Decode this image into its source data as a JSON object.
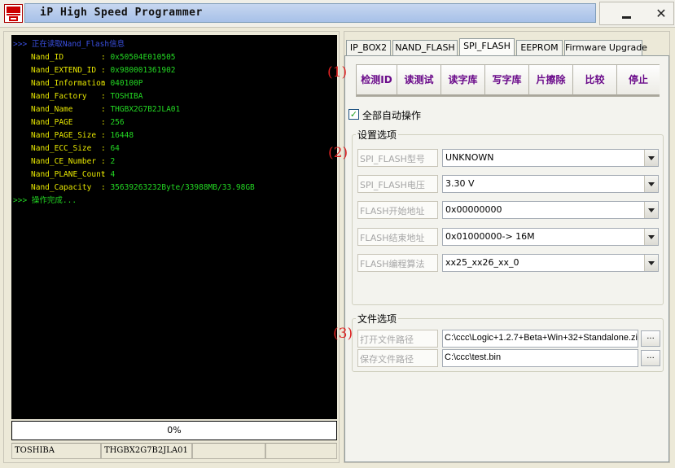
{
  "window": {
    "title": "iP High Speed Programmer"
  },
  "console": {
    "header": ">>> 正在读取Nand_Flash信息",
    "rows": [
      {
        "label": "Nand_ID",
        "value": "0x50504E010505"
      },
      {
        "label": "Nand_EXTEND_ID",
        "value": "0x980001361902"
      },
      {
        "label": "Nand_Information",
        "value": "040100P"
      },
      {
        "label": "Nand_Factory",
        "value": "TOSHIBA"
      },
      {
        "label": "Nand_Name",
        "value": "THGBX2G7B2JLA01"
      },
      {
        "label": "Nand_PAGE",
        "value": "256"
      },
      {
        "label": "Nand_PAGE_Size",
        "value": "16448"
      },
      {
        "label": "Nand_ECC_Size",
        "value": "64"
      },
      {
        "label": "Nand_CE_Number",
        "value": "2"
      },
      {
        "label": "Nand_PLANE_Count",
        "value": "4"
      },
      {
        "label": "Nand_Capacity",
        "value": "35639263232Byte/33988MB/33.98GB"
      }
    ],
    "separator": ": ",
    "footer": ">>> 操作完成..."
  },
  "progress": {
    "percent": 0,
    "label": "0%"
  },
  "statusbar": {
    "cells": [
      "TOSHIBA",
      "THGBX2G7B2JLA01",
      "",
      ""
    ]
  },
  "tabs": [
    {
      "label": "IP_BOX2"
    },
    {
      "label": "NAND_FLASH"
    },
    {
      "label": "SPI_FLASH"
    },
    {
      "label": "EEPROM"
    },
    {
      "label": "Firmware Upgrade"
    }
  ],
  "active_tab": "SPI_FLASH",
  "markers": [
    "(1)",
    "(2)",
    "(3)"
  ],
  "actions": [
    {
      "label": "检测ID"
    },
    {
      "label": "读测试"
    },
    {
      "label": "读字库"
    },
    {
      "label": "写字库"
    },
    {
      "label": "片擦除"
    },
    {
      "label": "比较"
    },
    {
      "label": "停止"
    }
  ],
  "auto_all": {
    "label": "全部自动操作",
    "checked": true
  },
  "settings": {
    "title": "设置选项",
    "fields": [
      {
        "label": "SPI_FLASH型号",
        "value": "UNKNOWN"
      },
      {
        "label": "SPI_FLASH电压",
        "value": "3.30 V"
      },
      {
        "label": "FLASH开始地址",
        "value": "0x00000000"
      },
      {
        "label": "FLASH结束地址",
        "value": "0x01000000-> 16M"
      },
      {
        "label": "FLASH编程算法",
        "value": "xx25_xx26_xx_0"
      }
    ]
  },
  "files": {
    "title": "文件选项",
    "open": {
      "label": "打开文件路径",
      "value": "C:\\ccc\\Logic+1.2.7+Beta+Win+32+Standalone.zi",
      "browse": "..."
    },
    "save": {
      "label": "保存文件路径",
      "value": "C:\\ccc\\test.bin",
      "browse": "..."
    }
  },
  "colors": {
    "console_bg": "#000000",
    "console_label": "#e6e600",
    "console_value": "#23d823",
    "console_header": "#3a4fe0",
    "action_text": "#6a0a8a",
    "marker": "#dd2222"
  },
  "icons": {
    "app": "programmer-logo-icon",
    "minimize": "minimize-icon",
    "close": "close-icon",
    "dropdown": "chevron-down-icon"
  }
}
